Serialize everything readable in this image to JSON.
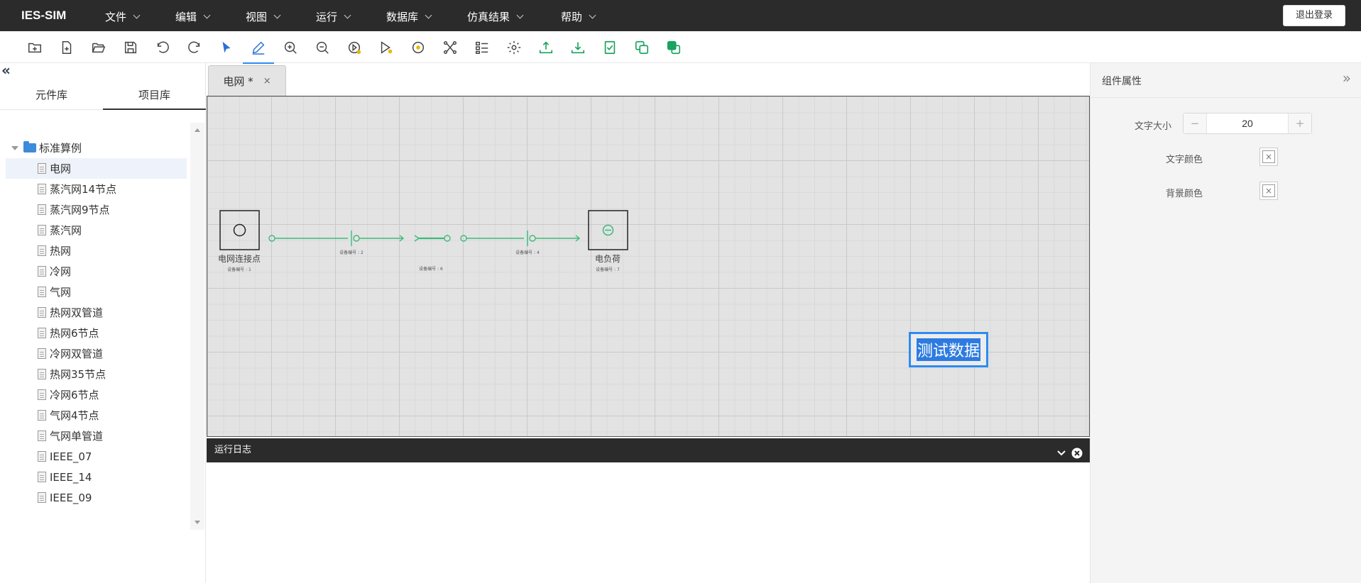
{
  "app": {
    "brand": "IES-SIM",
    "logout_label": "退出登录"
  },
  "menus": [
    "文件",
    "编辑",
    "视图",
    "运行",
    "数据库",
    "仿真结果",
    "帮助"
  ],
  "toolbar_icons": [
    "new-folder-icon",
    "new-file-icon",
    "open-folder-icon",
    "save-icon",
    "undo-icon",
    "redo-icon",
    "select-pointer-icon",
    "pencil-icon",
    "zoom-in-icon",
    "zoom-out-icon",
    "run-play-icon",
    "run-step-icon",
    "stop-circle-icon",
    "topology-icon",
    "list-settings-icon",
    "settings-gear-icon",
    "upload-icon",
    "download-icon",
    "checklist-icon",
    "copy-layer-icon",
    "layer-stack-icon"
  ],
  "left_panel": {
    "tabs": [
      "元件库",
      "项目库"
    ],
    "active_tab": 1,
    "tree": {
      "root": "标准算例",
      "items": [
        "电网",
        "蒸汽网14节点",
        "蒸汽网9节点",
        "蒸汽网",
        "热网",
        "冷网",
        "气网",
        "热网双管道",
        "热网6节点",
        "冷网双管道",
        "热网35节点",
        "冷网6节点",
        "气网4节点",
        "气网单管道",
        "IEEE_07",
        "IEEE_14",
        "IEEE_09"
      ],
      "selected_index": 0
    }
  },
  "document_tab": {
    "label": "电网 *",
    "close": "×"
  },
  "diagram": {
    "source_label": "电网连接点",
    "load_label": "电负荷",
    "device_labels": [
      "设备编号 : 1",
      "设备编号 : 2",
      "设备编号 : 6",
      "设备编号 : 4",
      "设备编号 : 7"
    ],
    "text_element": "测试数据"
  },
  "run_log": {
    "title": "运行日志"
  },
  "properties": {
    "title": "组件属性",
    "font_size_label": "文字大小",
    "font_size_value": "20",
    "minus": "−",
    "plus": "+",
    "text_color_label": "文字颜色",
    "bg_color_label": "背景颜色",
    "empty_swatch": "×"
  },
  "colors": {
    "menubar": "#2b2b2b",
    "accent": "#2d8cf0",
    "line": "#3dbb7a",
    "tool_blue": "#2d6fd6",
    "tool_green": "#1aa260"
  }
}
